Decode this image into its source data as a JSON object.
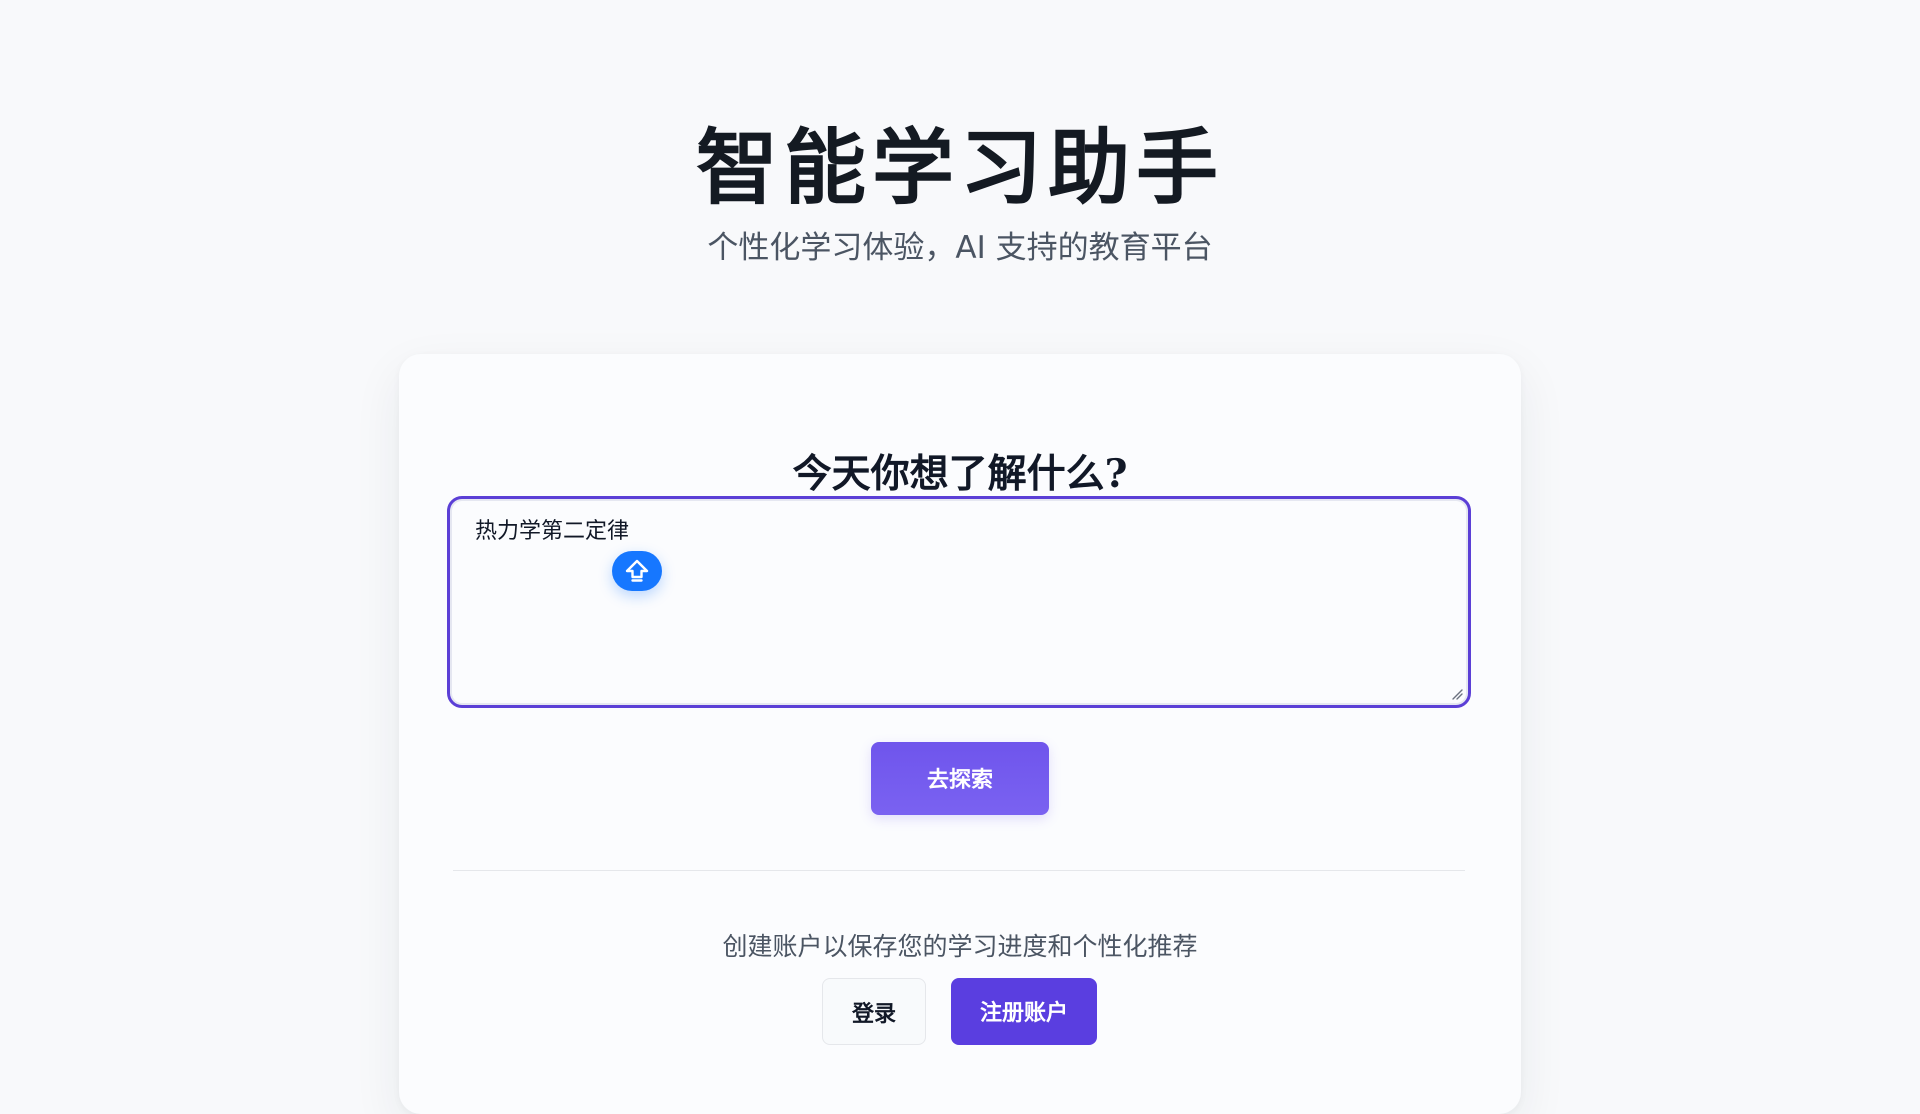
{
  "header": {
    "title": "智能学习助手",
    "subtitle": "个性化学习体验，AI 支持的教育平台"
  },
  "search": {
    "heading": "今天你想了解什么?",
    "query_value": "热力学第二定律",
    "floating_icon": "upload-arrow-icon"
  },
  "actions": {
    "explore_label": "去探索"
  },
  "account": {
    "hint": "创建账户以保存您的学习进度和个性化推荐",
    "login_label": "登录",
    "register_label": "注册账户"
  },
  "colors": {
    "accent": "#5a3ee0",
    "focus_border": "#5b3fd6",
    "floating_button": "#1677ff",
    "background": "#f8f9fb"
  }
}
